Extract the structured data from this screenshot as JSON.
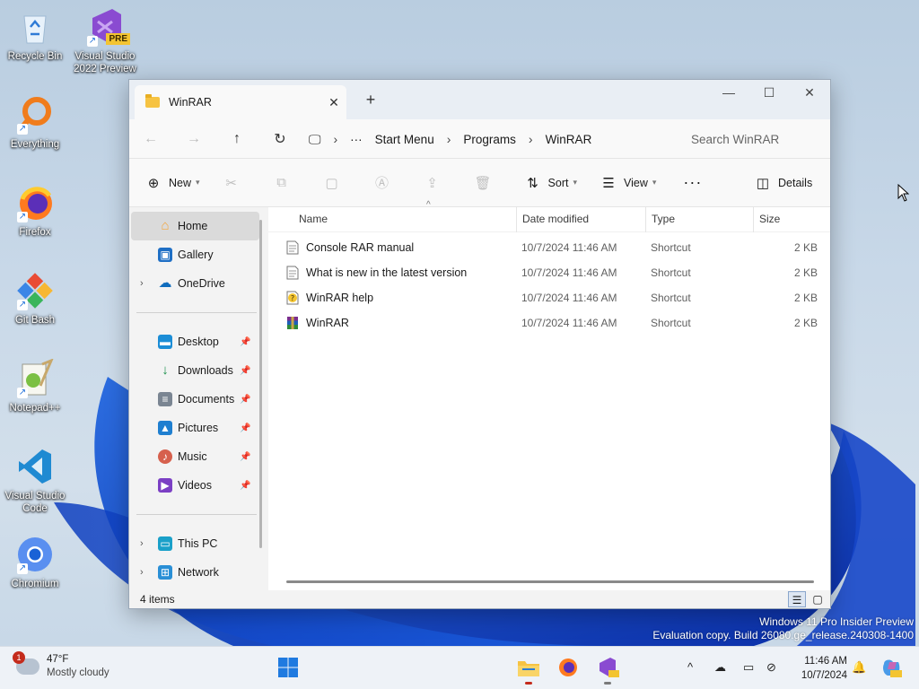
{
  "desktop": {
    "icons": [
      {
        "label": "Recycle Bin",
        "name": "recycle-bin"
      },
      {
        "label": "Visual Studio 2022 Preview",
        "name": "visual-studio-2022-preview"
      },
      {
        "label": "Everything",
        "name": "everything"
      },
      {
        "label": "Firefox",
        "name": "firefox"
      },
      {
        "label": "Git Bash",
        "name": "git-bash"
      },
      {
        "label": "Notepad++",
        "name": "notepad-plus-plus"
      },
      {
        "label": "Visual Studio Code",
        "name": "visual-studio-code"
      },
      {
        "label": "Chromium",
        "name": "chromium"
      }
    ],
    "vs_badge": "PRE",
    "watermark_line1": "Windows 11 Pro Insider Preview",
    "watermark_line2": "Evaluation copy. Build 26080.ge_release.240308-1400"
  },
  "window": {
    "tab_title": "WinRAR",
    "tab_close": "✕",
    "new_tab": "+",
    "minimize": "—",
    "maximize": "☐",
    "close": "✕"
  },
  "address": {
    "back": "←",
    "forward": "→",
    "up": "↑",
    "refresh": "↻",
    "computer_icon": "🖵",
    "overflow": "···",
    "crumbs": [
      "Start Menu",
      "Programs",
      "WinRAR"
    ],
    "sep": "›",
    "search_placeholder": "Search WinRAR"
  },
  "commandbar": {
    "new_label": "New",
    "sort_label": "Sort",
    "view_label": "View",
    "more": "···",
    "details_label": "Details"
  },
  "nav": {
    "items": [
      {
        "label": "Home",
        "icon": "home-icon",
        "glyph": "⌂",
        "color": "#f4a53c",
        "selected": true
      },
      {
        "label": "Gallery",
        "icon": "gallery-icon",
        "glyph": "▣",
        "color": "#1f6fc5"
      },
      {
        "label": "OneDrive",
        "icon": "onedrive-icon",
        "glyph": "☁",
        "color": "#0f6cbd",
        "expandable": true
      }
    ],
    "quick": [
      {
        "label": "Desktop",
        "icon": "desktop-icon",
        "glyph": "▬",
        "color": "#1b8dd6"
      },
      {
        "label": "Downloads",
        "icon": "downloads-icon",
        "glyph": "↓",
        "color": "#1a8f4a"
      },
      {
        "label": "Documents",
        "icon": "documents-icon",
        "glyph": "≡",
        "color": "#7a8592"
      },
      {
        "label": "Pictures",
        "icon": "pictures-icon",
        "glyph": "▲",
        "color": "#1f7fd0"
      },
      {
        "label": "Music",
        "icon": "music-icon",
        "glyph": "♪",
        "color": "#d6604d"
      },
      {
        "label": "Videos",
        "icon": "videos-icon",
        "glyph": "▶",
        "color": "#7b3fc4"
      }
    ],
    "pin_glyph": "📌",
    "bottom": [
      {
        "label": "This PC",
        "icon": "this-pc-icon",
        "glyph": "▭",
        "color": "#1aa0c9"
      },
      {
        "label": "Network",
        "icon": "network-icon",
        "glyph": "⊞",
        "color": "#2a8fd6"
      }
    ]
  },
  "files": {
    "columns": {
      "name": "Name",
      "date": "Date modified",
      "type": "Type",
      "size": "Size"
    },
    "rows": [
      {
        "name": "Console RAR manual",
        "date": "10/7/2024 11:46 AM",
        "type": "Shortcut",
        "size": "2 KB",
        "icon": "text-document-icon"
      },
      {
        "name": "What is new in the latest version",
        "date": "10/7/2024 11:46 AM",
        "type": "Shortcut",
        "size": "2 KB",
        "icon": "text-document-icon"
      },
      {
        "name": "WinRAR help",
        "date": "10/7/2024 11:46 AM",
        "type": "Shortcut",
        "size": "2 KB",
        "icon": "help-file-icon"
      },
      {
        "name": "WinRAR",
        "date": "10/7/2024 11:46 AM",
        "type": "Shortcut",
        "size": "2 KB",
        "icon": "winrar-icon"
      }
    ]
  },
  "status": {
    "items": "4 items"
  },
  "taskbar": {
    "weather_temp": "47°F",
    "weather_desc": "Mostly cloudy",
    "weather_badge": "1",
    "time": "11:46 AM",
    "date": "10/7/2024",
    "chevron": "^"
  }
}
